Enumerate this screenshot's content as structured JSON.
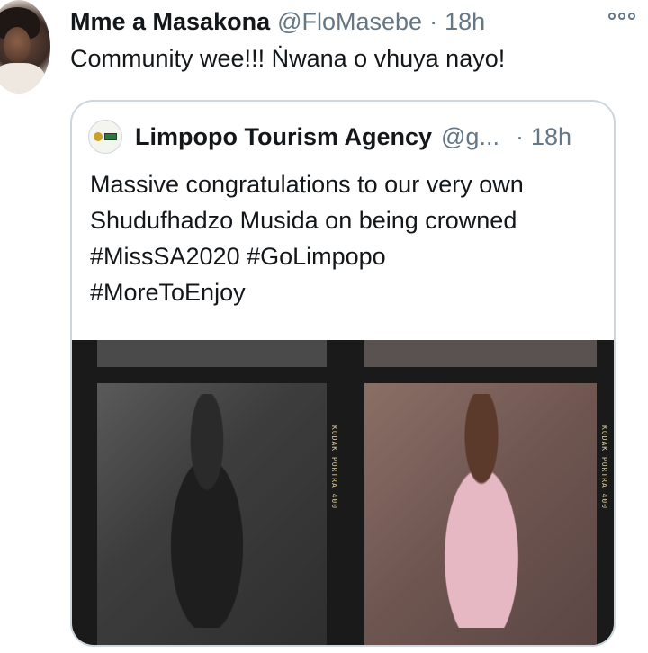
{
  "tweet": {
    "author_name": "Mme a Masakona",
    "handle": "@FloMasebe",
    "separator": "·",
    "time": "18h",
    "text": "Community wee!!! Ṅwana o vhuya nayo!"
  },
  "quoted": {
    "author_name": "Limpopo Tourism Agency",
    "handle": "@g...",
    "separator": "·",
    "time": "18h",
    "text_lines": [
      "Massive congratulations to our very own",
      "Shudufhadzo Musida on being crowned",
      "#MissSA2020 #GoLimpopo",
      "#MoreToEnjoy"
    ],
    "media": {
      "film_label_left": "KODAK PORTRA 400",
      "film_label_right": "KODAK PORTRA 400"
    }
  },
  "icons": {
    "more": "more-options-icon",
    "avatar": "avatar",
    "logo": "limpopo-logo"
  }
}
